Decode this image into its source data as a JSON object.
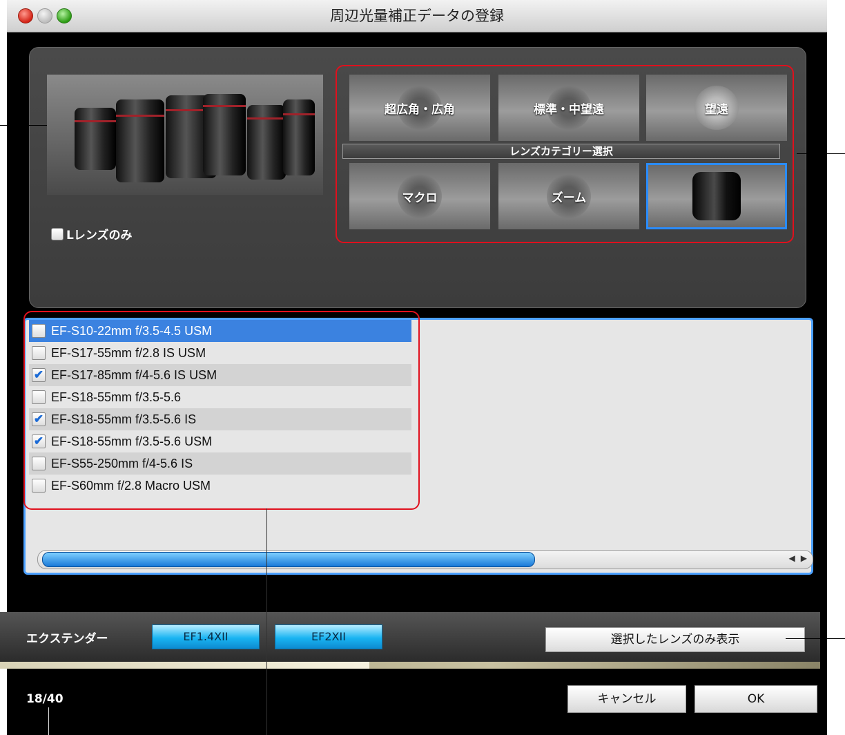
{
  "window": {
    "title": "周辺光量補正データの登録"
  },
  "filters": {
    "l_lens_only_label": "Lレンズのみ",
    "l_lens_only_checked": false
  },
  "categories": {
    "group_title": "レンズカテゴリー選択",
    "items": [
      {
        "label": "超広角・広角",
        "selected": false
      },
      {
        "label": "標準・中望遠",
        "selected": false
      },
      {
        "label": "望遠",
        "selected": false
      },
      {
        "label": "マクロ",
        "selected": false
      },
      {
        "label": "ズーム",
        "selected": false
      },
      {
        "label": "",
        "selected": true
      }
    ]
  },
  "lens_list": {
    "items": [
      {
        "name": "EF-S10-22mm f/3.5-4.5 USM",
        "checked": false,
        "highlighted": true
      },
      {
        "name": "EF-S17-55mm f/2.8 IS USM",
        "checked": false,
        "highlighted": false
      },
      {
        "name": "EF-S17-85mm f/4-5.6 IS USM",
        "checked": true,
        "highlighted": false
      },
      {
        "name": "EF-S18-55mm f/3.5-5.6",
        "checked": false,
        "highlighted": false
      },
      {
        "name": "EF-S18-55mm f/3.5-5.6 IS",
        "checked": true,
        "highlighted": false
      },
      {
        "name": "EF-S18-55mm f/3.5-5.6 USM",
        "checked": true,
        "highlighted": false
      },
      {
        "name": "EF-S55-250mm f/4-5.6 IS",
        "checked": false,
        "highlighted": false
      },
      {
        "name": "EF-S60mm f/2.8 Macro USM",
        "checked": false,
        "highlighted": false
      }
    ],
    "scroll_arrows": [
      "◀",
      "▶"
    ]
  },
  "extender": {
    "label": "エクステンダー",
    "buttons": [
      "EF1.4XII",
      "EF2XII"
    ]
  },
  "show_selected_label": "選択したレンズのみ表示",
  "progress": {
    "fraction": 0.45
  },
  "count_text": "18/40",
  "actions": {
    "cancel": "キャンセル",
    "ok": "OK"
  },
  "colors": {
    "accent_red": "#e0101d",
    "select_blue": "#3b82e0",
    "extender_blue": "#19b4f2"
  }
}
